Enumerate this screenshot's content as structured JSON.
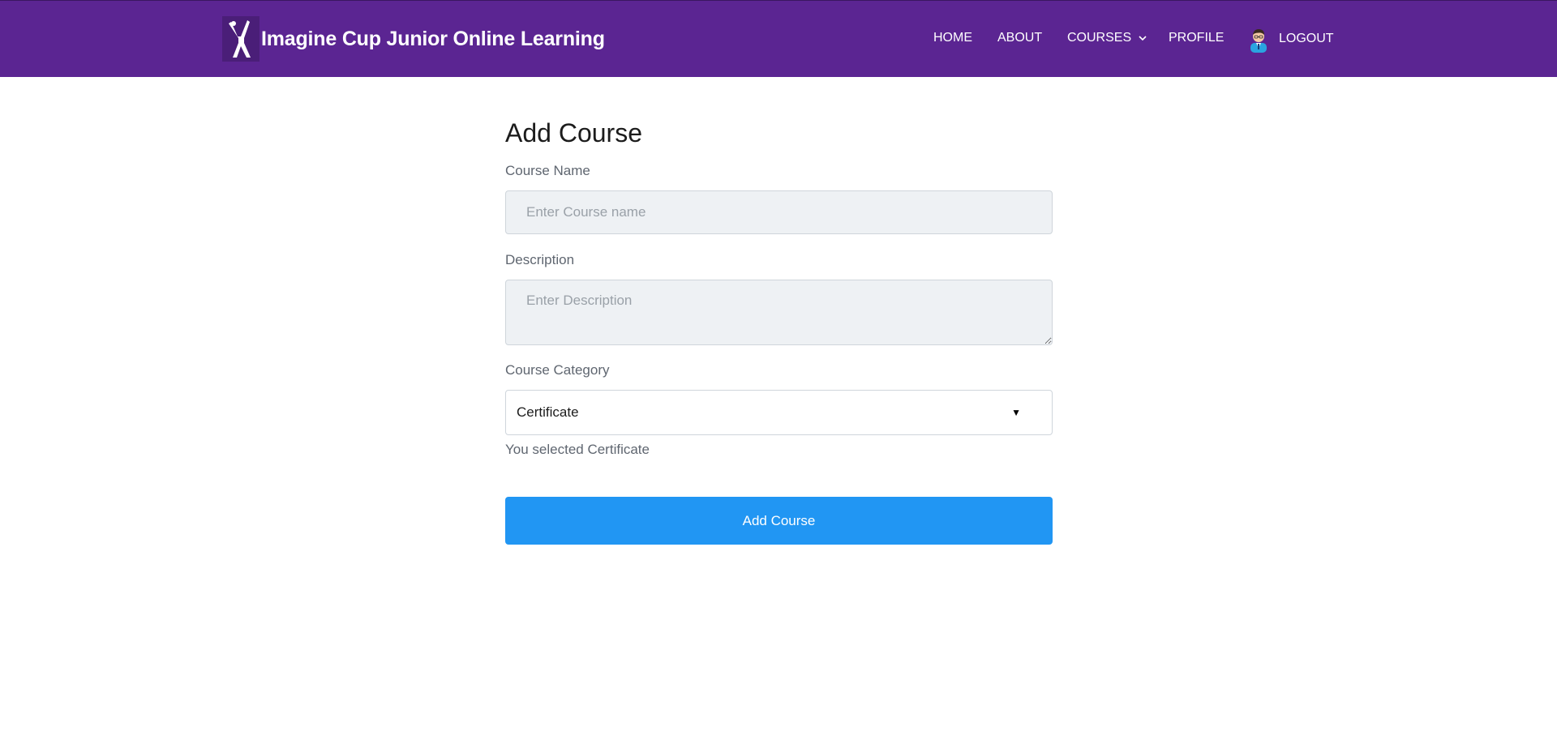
{
  "brand": {
    "name": "Imagine Cup Junior Online Learning",
    "logo_icon": "imagine-cup-figure-logo"
  },
  "nav": {
    "home": "HOME",
    "about": "ABOUT",
    "courses": "COURSES",
    "profile": "PROFILE",
    "logout": "LOGOUT",
    "avatar_icon": "user-avatar-icon"
  },
  "form": {
    "title": "Add Course",
    "course_name_label": "Course Name",
    "course_name_value": "",
    "course_name_placeholder": "Enter Course name",
    "description_label": "Description",
    "description_value": "",
    "description_placeholder": "Enter Description",
    "category_label": "Course Category",
    "category_selected": "Certificate",
    "selected_note": "You selected Certificate",
    "submit_label": "Add Course"
  },
  "colors": {
    "header_bg": "#5b2592",
    "button_bg": "#2196f3",
    "input_bg": "#eef1f4"
  }
}
